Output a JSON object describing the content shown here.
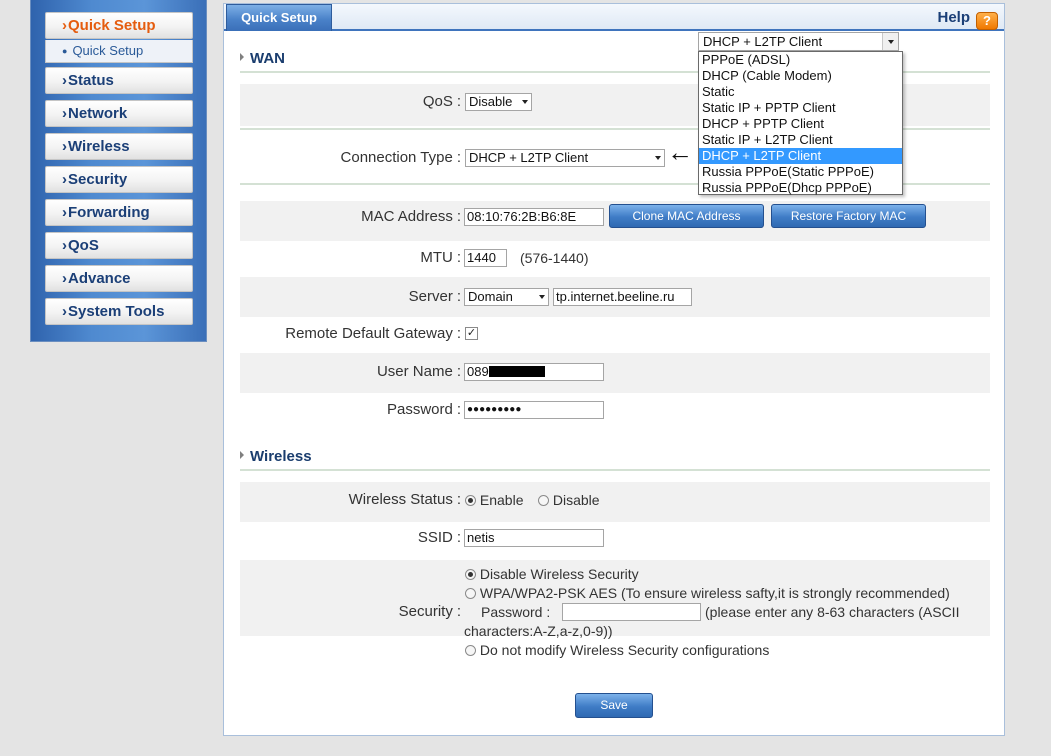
{
  "sidebar": {
    "items": [
      {
        "label": "Quick Setup",
        "active": true
      },
      {
        "label": "Status"
      },
      {
        "label": "Network"
      },
      {
        "label": "Wireless"
      },
      {
        "label": "Security"
      },
      {
        "label": "Forwarding"
      },
      {
        "label": "QoS"
      },
      {
        "label": "Advance"
      },
      {
        "label": "System Tools"
      }
    ],
    "sub_item": "Quick Setup"
  },
  "header": {
    "tab_label": "Quick Setup",
    "help_label": "Help",
    "help_icon": "?"
  },
  "wan": {
    "title": "WAN",
    "qos_label": "QoS",
    "qos_value": "Disable",
    "connection_type_label": "Connection Type",
    "connection_type_value": "DHCP + L2TP Client",
    "arrow_glyph": "←",
    "mac_label": "MAC Address",
    "mac_value": "08:10:76:2B:B6:8E",
    "clone_mac_label": "Clone MAC Address",
    "restore_mac_label": "Restore Factory MAC",
    "mtu_label": "MTU",
    "mtu_value": "1440",
    "mtu_hint": "(576-1440)",
    "server_label": "Server",
    "server_type": "Domain",
    "server_value": "tp.internet.beeline.ru",
    "gateway_label": "Remote Default Gateway",
    "gateway_checked": "✓",
    "username_label": "User Name",
    "username_value": "089",
    "password_label": "Password",
    "password_value": "●●●●●●●●●"
  },
  "wireless": {
    "title": "Wireless",
    "status_label": "Wireless Status",
    "enable_label": "Enable",
    "disable_label": "Disable",
    "ssid_label": "SSID",
    "ssid_value": "netis",
    "security_label": "Security",
    "opt_disable": "Disable Wireless Security",
    "opt_wpa": "WPA/WPA2-PSK AES (To ensure wireless safty,it is strongly recommended)",
    "wpa_password_label": "Password :",
    "wpa_hint_1": "(please enter any 8-63 characters (ASCII",
    "wpa_hint_2": "characters:A-Z,a-z,0-9))",
    "opt_nomodify": "Do not modify Wireless Security configurations"
  },
  "save_label": "Save",
  "dropdown": {
    "current": "DHCP + L2TP Client",
    "options": [
      "PPPoE (ADSL)",
      "DHCP (Cable Modem)",
      "Static",
      "Static IP + PPTP Client",
      "DHCP + PPTP Client",
      "Static IP + L2TP Client",
      "DHCP + L2TP Client",
      "Russia PPPoE(Static PPPoE)",
      "Russia PPPoE(Dhcp PPPoE)"
    ],
    "selected_index": 6
  },
  "colors": {
    "accent": "#3f74bd",
    "active_nav": "#e55c0e",
    "highlight": "#3399ff"
  }
}
